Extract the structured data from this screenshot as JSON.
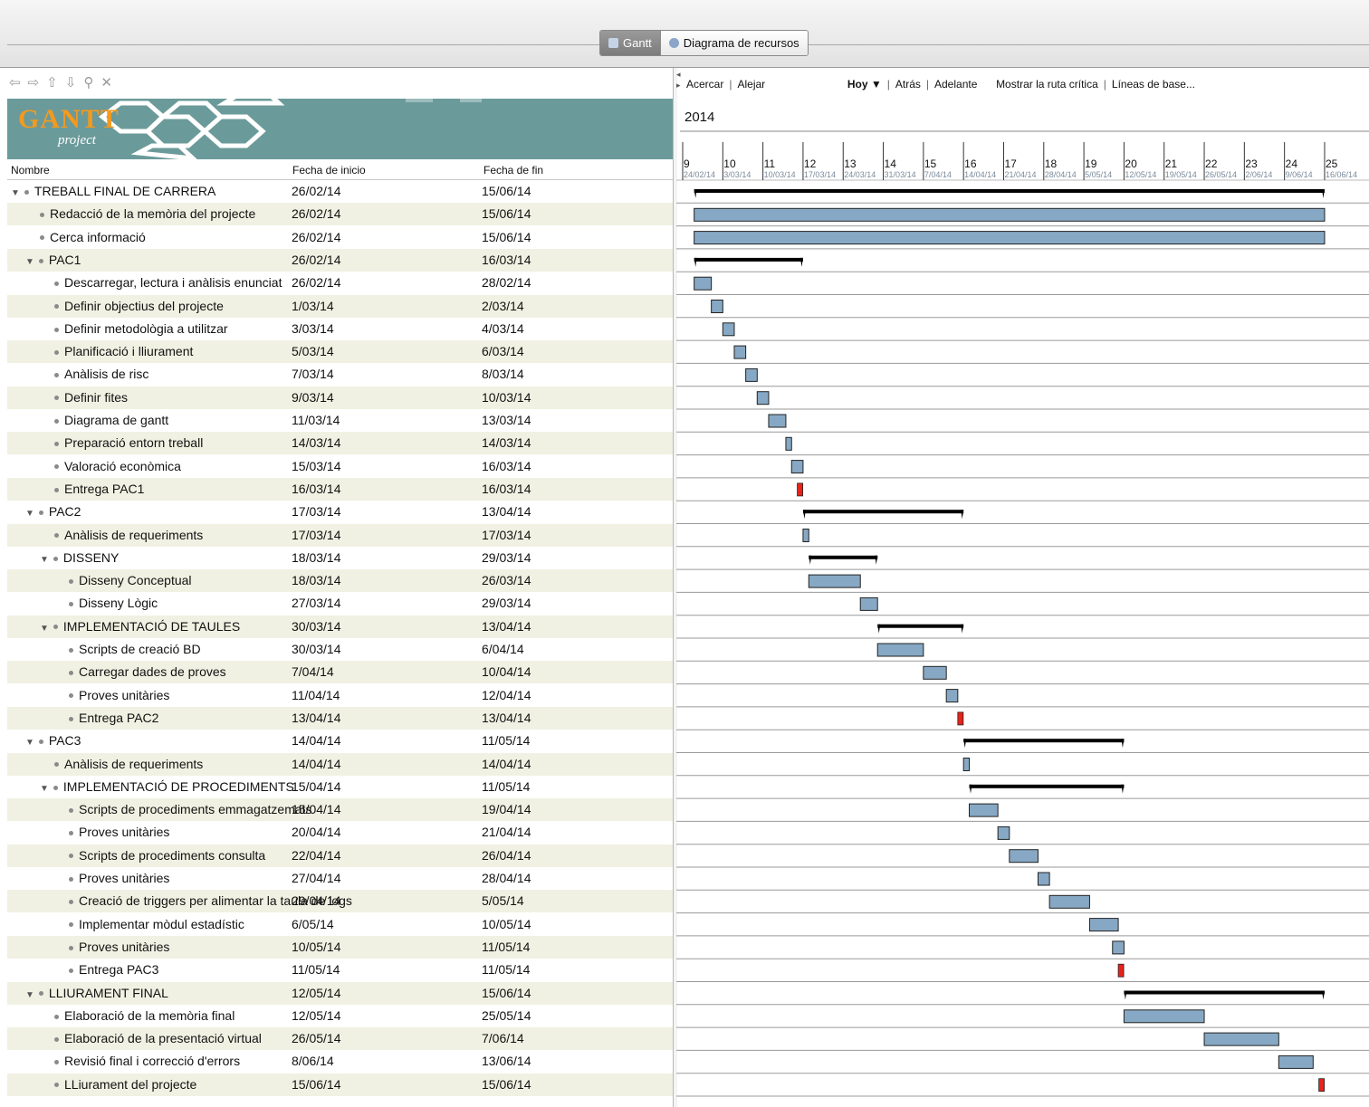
{
  "view_tabs": [
    {
      "label": "Gantt",
      "active": true
    },
    {
      "label": "Diagrama de recursos",
      "active": false
    }
  ],
  "left_toolbar": {
    "icons": [
      "arrow-left-icon",
      "arrow-right-icon",
      "arrow-up-icon",
      "arrow-down-icon",
      "link-icon",
      "unlink-icon"
    ]
  },
  "logo": {
    "word": "GANTT",
    "sub": "project"
  },
  "columns": {
    "name": "Nombre",
    "start": "Fecha de inicio",
    "end": "Fecha de fin"
  },
  "chart_toolbar": {
    "zoom_in": "Acercar",
    "zoom_out": "Alejar",
    "today": "Hoy ▼",
    "back": "Atrás",
    "forward": "Adelante",
    "critical_path": "Mostrar la ruta crítica",
    "baselines": "Líneas de base..."
  },
  "timeline": {
    "year": "2014",
    "weeks": [
      {
        "num": "9",
        "date": "24/02/14"
      },
      {
        "num": "10",
        "date": "3/03/14"
      },
      {
        "num": "11",
        "date": "10/03/14"
      },
      {
        "num": "12",
        "date": "17/03/14"
      },
      {
        "num": "13",
        "date": "24/03/14"
      },
      {
        "num": "14",
        "date": "31/03/14"
      },
      {
        "num": "15",
        "date": "7/04/14"
      },
      {
        "num": "16",
        "date": "14/04/14"
      },
      {
        "num": "17",
        "date": "21/04/14"
      },
      {
        "num": "18",
        "date": "28/04/14"
      },
      {
        "num": "19",
        "date": "5/05/14"
      },
      {
        "num": "20",
        "date": "12/05/14"
      },
      {
        "num": "21",
        "date": "19/05/14"
      },
      {
        "num": "22",
        "date": "26/05/14"
      },
      {
        "num": "23",
        "date": "2/06/14"
      },
      {
        "num": "24",
        "date": "9/06/14"
      },
      {
        "num": "25",
        "date": "16/06/14"
      }
    ]
  },
  "colors": {
    "task": "#86a8c4",
    "milestone": "#e8231b",
    "summary": "#000000"
  },
  "tasks": [
    {
      "name": "TREBALL FINAL DE CARRERA",
      "start": "26/02/14",
      "end": "15/06/14",
      "level": 0,
      "group": true
    },
    {
      "name": "Redacció de la memòria del projecte",
      "start": "26/02/14",
      "end": "15/06/14",
      "level": 1,
      "group": false
    },
    {
      "name": "Cerca informació",
      "start": "26/02/14",
      "end": "15/06/14",
      "level": 1,
      "group": false
    },
    {
      "name": "PAC1",
      "start": "26/02/14",
      "end": "16/03/14",
      "level": 1,
      "group": true
    },
    {
      "name": "Descarregar, lectura i anàlisis enunciat",
      "start": "26/02/14",
      "end": "28/02/14",
      "level": 2,
      "group": false
    },
    {
      "name": "Definir objectius del projecte",
      "start": "1/03/14",
      "end": "2/03/14",
      "level": 2,
      "group": false
    },
    {
      "name": "Definir metodològia a utilitzar",
      "start": "3/03/14",
      "end": "4/03/14",
      "level": 2,
      "group": false
    },
    {
      "name": "Planificació i lliurament",
      "start": "5/03/14",
      "end": "6/03/14",
      "level": 2,
      "group": false
    },
    {
      "name": "Anàlisis de risc",
      "start": "7/03/14",
      "end": "8/03/14",
      "level": 2,
      "group": false
    },
    {
      "name": "Definir fites",
      "start": "9/03/14",
      "end": "10/03/14",
      "level": 2,
      "group": false
    },
    {
      "name": "Diagrama de gantt",
      "start": "11/03/14",
      "end": "13/03/14",
      "level": 2,
      "group": false
    },
    {
      "name": "Preparació entorn treball",
      "start": "14/03/14",
      "end": "14/03/14",
      "level": 2,
      "group": false
    },
    {
      "name": "Valoració econòmica",
      "start": "15/03/14",
      "end": "16/03/14",
      "level": 2,
      "group": false
    },
    {
      "name": "Entrega PAC1",
      "start": "16/03/14",
      "end": "16/03/14",
      "level": 2,
      "group": false,
      "milestone": true
    },
    {
      "name": "PAC2",
      "start": "17/03/14",
      "end": "13/04/14",
      "level": 1,
      "group": true
    },
    {
      "name": "Anàlisis de requeriments",
      "start": "17/03/14",
      "end": "17/03/14",
      "level": 2,
      "group": false
    },
    {
      "name": "DISSENY",
      "start": "18/03/14",
      "end": "29/03/14",
      "level": 2,
      "group": true
    },
    {
      "name": "Disseny Conceptual",
      "start": "18/03/14",
      "end": "26/03/14",
      "level": 3,
      "group": false
    },
    {
      "name": "Disseny Lògic",
      "start": "27/03/14",
      "end": "29/03/14",
      "level": 3,
      "group": false
    },
    {
      "name": "IMPLEMENTACIÓ DE TAULES",
      "start": "30/03/14",
      "end": "13/04/14",
      "level": 2,
      "group": true
    },
    {
      "name": "Scripts de creació BD",
      "start": "30/03/14",
      "end": "6/04/14",
      "level": 3,
      "group": false
    },
    {
      "name": "Carregar dades de proves",
      "start": "7/04/14",
      "end": "10/04/14",
      "level": 3,
      "group": false
    },
    {
      "name": "Proves unitàries",
      "start": "11/04/14",
      "end": "12/04/14",
      "level": 3,
      "group": false
    },
    {
      "name": "Entrega PAC2",
      "start": "13/04/14",
      "end": "13/04/14",
      "level": 3,
      "group": false,
      "milestone": true
    },
    {
      "name": "PAC3",
      "start": "14/04/14",
      "end": "11/05/14",
      "level": 1,
      "group": true
    },
    {
      "name": "Anàlisis de requeriments",
      "start": "14/04/14",
      "end": "14/04/14",
      "level": 2,
      "group": false
    },
    {
      "name": "IMPLEMENTACIÓ DE PROCEDIMENTS",
      "start": "15/04/14",
      "end": "11/05/14",
      "level": 2,
      "group": true
    },
    {
      "name": "Scripts de procediments emmagatzemats",
      "start": "15/04/14",
      "end": "19/04/14",
      "level": 3,
      "group": false
    },
    {
      "name": "Proves unitàries",
      "start": "20/04/14",
      "end": "21/04/14",
      "level": 3,
      "group": false
    },
    {
      "name": "Scripts de procediments consulta",
      "start": "22/04/14",
      "end": "26/04/14",
      "level": 3,
      "group": false
    },
    {
      "name": "Proves unitàries",
      "start": "27/04/14",
      "end": "28/04/14",
      "level": 3,
      "group": false
    },
    {
      "name": "Creació de triggers per alimentar la taula de logs",
      "start": "29/04/14",
      "end": "5/05/14",
      "level": 3,
      "group": false
    },
    {
      "name": "Implementar mòdul estadístic",
      "start": "6/05/14",
      "end": "10/05/14",
      "level": 3,
      "group": false
    },
    {
      "name": "Proves unitàries",
      "start": "10/05/14",
      "end": "11/05/14",
      "level": 3,
      "group": false
    },
    {
      "name": "Entrega PAC3",
      "start": "11/05/14",
      "end": "11/05/14",
      "level": 3,
      "group": false,
      "milestone": true
    },
    {
      "name": "LLIURAMENT FINAL",
      "start": "12/05/14",
      "end": "15/06/14",
      "level": 1,
      "group": true
    },
    {
      "name": "Elaboració de la memòria final",
      "start": "12/05/14",
      "end": "25/05/14",
      "level": 2,
      "group": false
    },
    {
      "name": "Elaboració de la presentació virtual",
      "start": "26/05/14",
      "end": "7/06/14",
      "level": 2,
      "group": false
    },
    {
      "name": "Revisió final i correcció d'errors",
      "start": "8/06/14",
      "end": "13/06/14",
      "level": 2,
      "group": false
    },
    {
      "name": "LLiurament del projecte",
      "start": "15/06/14",
      "end": "15/06/14",
      "level": 2,
      "group": false,
      "milestone": true
    }
  ]
}
